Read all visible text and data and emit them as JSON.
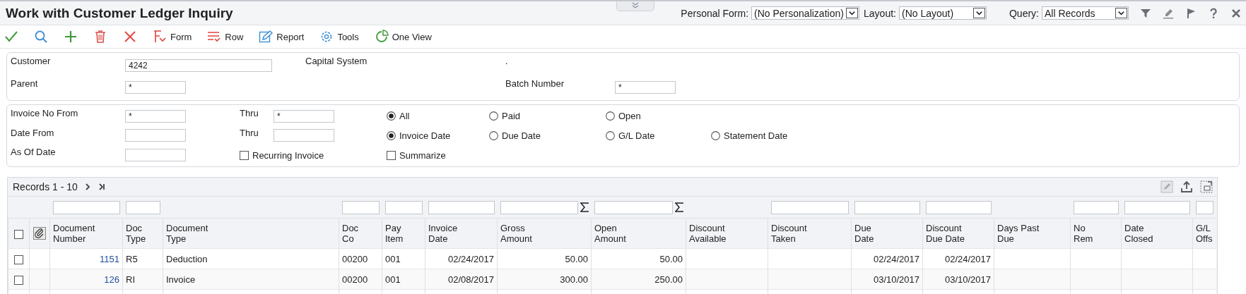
{
  "header": {
    "title": "Work with Customer Ledger Inquiry",
    "personal_form": {
      "label": "Personal Form:",
      "value": "(No Personalization)"
    },
    "layout": {
      "label": "Layout:",
      "value": "(No Layout)"
    },
    "query": {
      "label": "Query:",
      "value": "All Records"
    },
    "actions": [
      {
        "kind": "filter"
      },
      {
        "kind": "pen"
      },
      {
        "kind": "flag"
      },
      {
        "kind": "help"
      },
      {
        "kind": "close"
      }
    ]
  },
  "toolbar": [
    {
      "kind": "ok"
    },
    {
      "kind": "find"
    },
    {
      "kind": "add"
    },
    {
      "kind": "delete"
    },
    {
      "kind": "cancel"
    },
    {
      "kind": "form",
      "label": "Form"
    },
    {
      "kind": "row",
      "label": "Row"
    },
    {
      "kind": "report",
      "label": "Report"
    },
    {
      "kind": "tools",
      "label": "Tools"
    },
    {
      "kind": "oneview",
      "label": "One View"
    }
  ],
  "customer_panel": {
    "customer": {
      "label": "Customer",
      "value": "4242"
    },
    "customer_name": "Capital System",
    "parent_name": ".",
    "parent": {
      "label": "Parent",
      "value": "*"
    },
    "batch_number": {
      "label": "Batch Number",
      "value": "*"
    }
  },
  "filter_panel": {
    "invoice_from": {
      "label": "Invoice No From",
      "value": "*"
    },
    "invoice_thru": {
      "label": "Thru",
      "value": "*"
    },
    "date_from": {
      "label": "Date From"
    },
    "date_thru": {
      "label": "Thru"
    },
    "as_of_date": {
      "label": "As Of Date"
    },
    "status": [
      {
        "label": "All",
        "selected": true
      },
      {
        "label": "Paid",
        "selected": false
      },
      {
        "label": "Open",
        "selected": false
      }
    ],
    "date_basis": [
      {
        "label": "Invoice Date",
        "selected": true
      },
      {
        "label": "Due Date",
        "selected": false
      },
      {
        "label": "G/L Date",
        "selected": false
      },
      {
        "label": "Statement Date",
        "selected": false
      }
    ],
    "recurring_invoice": {
      "label": "Recurring Invoice",
      "checked": false
    },
    "summarize": {
      "label": "Summarize",
      "checked": false
    }
  },
  "grid": {
    "records": "Records 1 - 10",
    "select_all": {
      "checked": false
    },
    "columns": [
      {
        "heading": [
          "Document",
          "Number"
        ],
        "kind": "link",
        "filter": true,
        "sum": false
      },
      {
        "heading": [
          "Doc",
          "Type"
        ],
        "kind": "text",
        "filter": true,
        "sum": false
      },
      {
        "heading": [
          "Document",
          "Type"
        ],
        "kind": "text",
        "filter": false,
        "sum": false
      },
      {
        "heading": [
          "Doc",
          "Co"
        ],
        "kind": "text",
        "filter": true,
        "sum": false
      },
      {
        "heading": [
          "Pay",
          "Item"
        ],
        "kind": "text",
        "filter": true,
        "sum": false
      },
      {
        "heading": [
          "Invoice",
          "Date"
        ],
        "kind": "text",
        "filter": true,
        "sum": false
      },
      {
        "heading": [
          "Gross",
          "Amount"
        ],
        "kind": "text",
        "filter": true,
        "sum": true
      },
      {
        "heading": [
          "Open",
          "Amount"
        ],
        "kind": "text",
        "filter": true,
        "sum": true
      },
      {
        "heading": [
          "Discount",
          "Available"
        ],
        "kind": "text",
        "filter": false,
        "sum": false
      },
      {
        "heading": [
          "Discount",
          "Taken"
        ],
        "kind": "text",
        "filter": true,
        "sum": false
      },
      {
        "heading": [
          "Due",
          "Date"
        ],
        "kind": "text",
        "filter": true,
        "sum": false
      },
      {
        "heading": [
          "Discount",
          "Due Date"
        ],
        "kind": "text",
        "filter": true,
        "sum": false
      },
      {
        "heading": [
          "Days Past",
          "Due"
        ],
        "kind": "text",
        "filter": false,
        "sum": false
      },
      {
        "heading": [
          "No",
          "Rem"
        ],
        "kind": "text",
        "filter": true,
        "sum": false
      },
      {
        "heading": [
          "Date",
          "Closed"
        ],
        "kind": "text",
        "filter": true,
        "sum": false
      },
      {
        "heading": [
          "G/L",
          "Offs"
        ],
        "kind": "text",
        "filter": true,
        "sum": false
      }
    ],
    "rows": [
      {
        "checked": false,
        "cells": [
          "1151",
          "R5",
          "Deduction",
          "00200",
          "001",
          "02/24/2017",
          "50.00",
          "50.00",
          "",
          "",
          "02/24/2017",
          "02/24/2017",
          "",
          "",
          "",
          ""
        ]
      },
      {
        "checked": false,
        "cells": [
          "126",
          "RI",
          "Invoice",
          "00200",
          "001",
          "02/08/2017",
          "300.00",
          "250.00",
          "",
          "",
          "03/10/2017",
          "03/10/2017",
          "",
          "",
          "",
          ""
        ]
      }
    ]
  }
}
